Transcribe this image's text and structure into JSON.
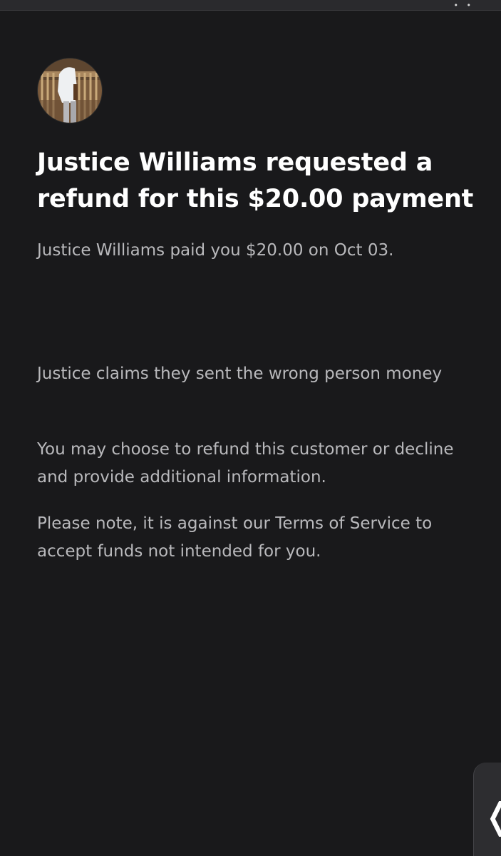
{
  "status_bar": {
    "glyph": "• •"
  },
  "avatar": {
    "icon": "user-photo"
  },
  "refund_request": {
    "title": "Justice Williams requested a refund for this $20.00 payment",
    "subtitle": "Justice Williams paid you $20.00 on Oct 03.",
    "claim": "Justice claims they sent the wrong person money",
    "options": "You may choose to refund this customer or decline and provide additional information.",
    "note": "Please note, it is against our Terms of Service to accept funds not intended for you."
  },
  "side_tab": {
    "icon": "chevron-left-icon",
    "glyph": "❬"
  },
  "colors": {
    "background": "#19191b",
    "title": "#ffffff",
    "body_text": "#b9b9bc"
  }
}
